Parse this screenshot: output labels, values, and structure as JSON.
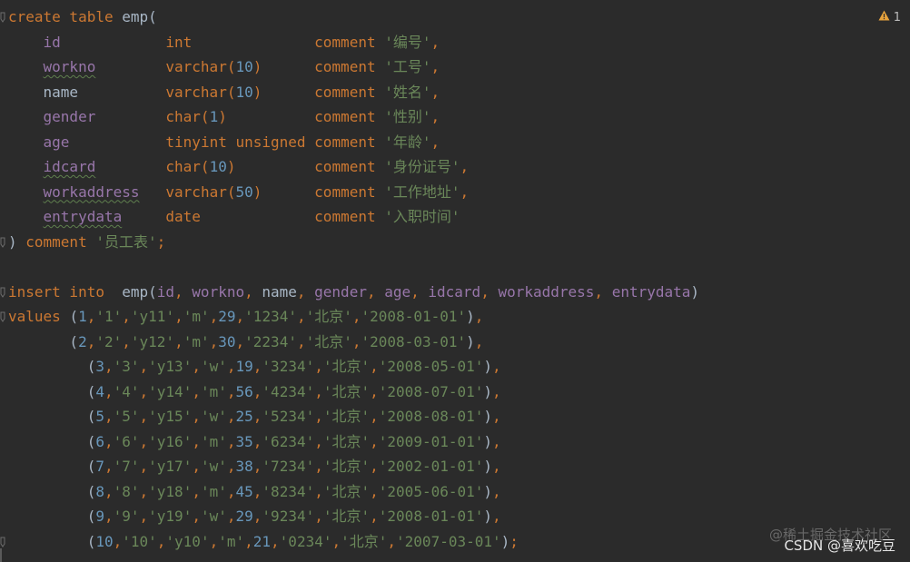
{
  "editor": {
    "warning_count": "1",
    "lines": [
      [
        [
          "kw",
          "create table "
        ],
        [
          "id",
          "emp("
        ]
      ],
      [
        [
          "id",
          "    "
        ],
        [
          "col",
          "id"
        ],
        [
          "id",
          "            "
        ],
        [
          "kw",
          "int"
        ],
        [
          "id",
          "              "
        ],
        [
          "kw",
          "comment "
        ],
        [
          "str",
          "'编号'"
        ],
        [
          "kw",
          ","
        ]
      ],
      [
        [
          "id",
          "    "
        ],
        [
          "col typo",
          "workno"
        ],
        [
          "id",
          "        "
        ],
        [
          "kw",
          "varchar("
        ],
        [
          "num",
          "10"
        ],
        [
          "kw",
          ")"
        ],
        [
          "id",
          "      "
        ],
        [
          "kw",
          "comment "
        ],
        [
          "str",
          "'工号'"
        ],
        [
          "kw",
          ","
        ]
      ],
      [
        [
          "id",
          "    "
        ],
        [
          "id",
          "name"
        ],
        [
          "id",
          "          "
        ],
        [
          "kw",
          "varchar("
        ],
        [
          "num",
          "10"
        ],
        [
          "kw",
          ")"
        ],
        [
          "id",
          "      "
        ],
        [
          "kw",
          "comment "
        ],
        [
          "str",
          "'姓名'"
        ],
        [
          "kw",
          ","
        ]
      ],
      [
        [
          "id",
          "    "
        ],
        [
          "col",
          "gender"
        ],
        [
          "id",
          "        "
        ],
        [
          "kw",
          "char("
        ],
        [
          "num",
          "1"
        ],
        [
          "kw",
          ")"
        ],
        [
          "id",
          "          "
        ],
        [
          "kw",
          "comment "
        ],
        [
          "str",
          "'性别'"
        ],
        [
          "kw",
          ","
        ]
      ],
      [
        [
          "id",
          "    "
        ],
        [
          "col",
          "age"
        ],
        [
          "id",
          "           "
        ],
        [
          "kw",
          "tinyint unsigned"
        ],
        [
          "id",
          " "
        ],
        [
          "kw",
          "comment "
        ],
        [
          "str",
          "'年龄'"
        ],
        [
          "kw",
          ","
        ]
      ],
      [
        [
          "id",
          "    "
        ],
        [
          "col typo",
          "idcard"
        ],
        [
          "id",
          "        "
        ],
        [
          "kw",
          "char("
        ],
        [
          "num",
          "10"
        ],
        [
          "kw",
          ")"
        ],
        [
          "id",
          "         "
        ],
        [
          "kw",
          "comment "
        ],
        [
          "str",
          "'身份证号'"
        ],
        [
          "kw",
          ","
        ]
      ],
      [
        [
          "id",
          "    "
        ],
        [
          "col typo",
          "workaddress"
        ],
        [
          "id",
          "   "
        ],
        [
          "kw",
          "varchar("
        ],
        [
          "num",
          "50"
        ],
        [
          "kw",
          ")"
        ],
        [
          "id",
          "      "
        ],
        [
          "kw",
          "comment "
        ],
        [
          "str",
          "'工作地址'"
        ],
        [
          "kw",
          ","
        ]
      ],
      [
        [
          "id",
          "    "
        ],
        [
          "col typo",
          "entrydata"
        ],
        [
          "id",
          "     "
        ],
        [
          "kw",
          "date"
        ],
        [
          "id",
          "             "
        ],
        [
          "kw",
          "comment "
        ],
        [
          "str",
          "'入职时间'"
        ]
      ],
      [
        [
          "id",
          ") "
        ],
        [
          "kw",
          "comment "
        ],
        [
          "str",
          "'员工表'"
        ],
        [
          "kw",
          ";"
        ]
      ],
      [
        [
          "id",
          ""
        ]
      ],
      [
        [
          "kw",
          "insert into  "
        ],
        [
          "id",
          "emp("
        ],
        [
          "col",
          "id"
        ],
        [
          "kw",
          ", "
        ],
        [
          "col",
          "workno"
        ],
        [
          "kw",
          ", "
        ],
        [
          "id",
          "name"
        ],
        [
          "kw",
          ", "
        ],
        [
          "col",
          "gender"
        ],
        [
          "kw",
          ", "
        ],
        [
          "col",
          "age"
        ],
        [
          "kw",
          ", "
        ],
        [
          "col",
          "idcard"
        ],
        [
          "kw",
          ", "
        ],
        [
          "col",
          "workaddress"
        ],
        [
          "kw",
          ", "
        ],
        [
          "col",
          "entrydata"
        ],
        [
          "id",
          ")"
        ]
      ],
      [
        [
          "kw",
          "values "
        ],
        [
          "id",
          "("
        ],
        [
          "num",
          "1"
        ],
        [
          "kw",
          ","
        ],
        [
          "str",
          "'1'"
        ],
        [
          "kw",
          ","
        ],
        [
          "str",
          "'y11'"
        ],
        [
          "kw",
          ","
        ],
        [
          "str",
          "'m'"
        ],
        [
          "kw",
          ","
        ],
        [
          "num",
          "29"
        ],
        [
          "kw",
          ","
        ],
        [
          "str",
          "'1234'"
        ],
        [
          "kw",
          ","
        ],
        [
          "str",
          "'北京'"
        ],
        [
          "kw",
          ","
        ],
        [
          "str",
          "'2008-01-01'"
        ],
        [
          "id",
          ")"
        ],
        [
          "kw",
          ","
        ]
      ],
      [
        [
          "id",
          "       ("
        ],
        [
          "num",
          "2"
        ],
        [
          "kw",
          ","
        ],
        [
          "str",
          "'2'"
        ],
        [
          "kw",
          ","
        ],
        [
          "str",
          "'y12'"
        ],
        [
          "kw",
          ","
        ],
        [
          "str",
          "'m'"
        ],
        [
          "kw",
          ","
        ],
        [
          "num",
          "30"
        ],
        [
          "kw",
          ","
        ],
        [
          "str",
          "'2234'"
        ],
        [
          "kw",
          ","
        ],
        [
          "str",
          "'北京'"
        ],
        [
          "kw",
          ","
        ],
        [
          "str",
          "'2008-03-01'"
        ],
        [
          "id",
          ")"
        ],
        [
          "kw",
          ","
        ]
      ],
      [
        [
          "id",
          "         ("
        ],
        [
          "num",
          "3"
        ],
        [
          "kw",
          ","
        ],
        [
          "str",
          "'3'"
        ],
        [
          "kw",
          ","
        ],
        [
          "str",
          "'y13'"
        ],
        [
          "kw",
          ","
        ],
        [
          "str",
          "'w'"
        ],
        [
          "kw",
          ","
        ],
        [
          "num",
          "19"
        ],
        [
          "kw",
          ","
        ],
        [
          "str",
          "'3234'"
        ],
        [
          "kw",
          ","
        ],
        [
          "str",
          "'北京'"
        ],
        [
          "kw",
          ","
        ],
        [
          "str",
          "'2008-05-01'"
        ],
        [
          "id",
          ")"
        ],
        [
          "kw",
          ","
        ]
      ],
      [
        [
          "id",
          "         ("
        ],
        [
          "num",
          "4"
        ],
        [
          "kw",
          ","
        ],
        [
          "str",
          "'4'"
        ],
        [
          "kw",
          ","
        ],
        [
          "str",
          "'y14'"
        ],
        [
          "kw",
          ","
        ],
        [
          "str",
          "'m'"
        ],
        [
          "kw",
          ","
        ],
        [
          "num",
          "56"
        ],
        [
          "kw",
          ","
        ],
        [
          "str",
          "'4234'"
        ],
        [
          "kw",
          ","
        ],
        [
          "str",
          "'北京'"
        ],
        [
          "kw",
          ","
        ],
        [
          "str",
          "'2008-07-01'"
        ],
        [
          "id",
          ")"
        ],
        [
          "kw",
          ","
        ]
      ],
      [
        [
          "id",
          "         ("
        ],
        [
          "num",
          "5"
        ],
        [
          "kw",
          ","
        ],
        [
          "str",
          "'5'"
        ],
        [
          "kw",
          ","
        ],
        [
          "str",
          "'y15'"
        ],
        [
          "kw",
          ","
        ],
        [
          "str",
          "'w'"
        ],
        [
          "kw",
          ","
        ],
        [
          "num",
          "25"
        ],
        [
          "kw",
          ","
        ],
        [
          "str",
          "'5234'"
        ],
        [
          "kw",
          ","
        ],
        [
          "str",
          "'北京'"
        ],
        [
          "kw",
          ","
        ],
        [
          "str",
          "'2008-08-01'"
        ],
        [
          "id",
          ")"
        ],
        [
          "kw",
          ","
        ]
      ],
      [
        [
          "id",
          "         ("
        ],
        [
          "num",
          "6"
        ],
        [
          "kw",
          ","
        ],
        [
          "str",
          "'6'"
        ],
        [
          "kw",
          ","
        ],
        [
          "str",
          "'y16'"
        ],
        [
          "kw",
          ","
        ],
        [
          "str",
          "'m'"
        ],
        [
          "kw",
          ","
        ],
        [
          "num",
          "35"
        ],
        [
          "kw",
          ","
        ],
        [
          "str",
          "'6234'"
        ],
        [
          "kw",
          ","
        ],
        [
          "str",
          "'北京'"
        ],
        [
          "kw",
          ","
        ],
        [
          "str",
          "'2009-01-01'"
        ],
        [
          "id",
          ")"
        ],
        [
          "kw",
          ","
        ]
      ],
      [
        [
          "id",
          "         ("
        ],
        [
          "num",
          "7"
        ],
        [
          "kw",
          ","
        ],
        [
          "str",
          "'7'"
        ],
        [
          "kw",
          ","
        ],
        [
          "str",
          "'y17'"
        ],
        [
          "kw",
          ","
        ],
        [
          "str",
          "'w'"
        ],
        [
          "kw",
          ","
        ],
        [
          "num",
          "38"
        ],
        [
          "kw",
          ","
        ],
        [
          "str",
          "'7234'"
        ],
        [
          "kw",
          ","
        ],
        [
          "str",
          "'北京'"
        ],
        [
          "kw",
          ","
        ],
        [
          "str",
          "'2002-01-01'"
        ],
        [
          "id",
          ")"
        ],
        [
          "kw",
          ","
        ]
      ],
      [
        [
          "id",
          "         ("
        ],
        [
          "num",
          "8"
        ],
        [
          "kw",
          ","
        ],
        [
          "str",
          "'8'"
        ],
        [
          "kw",
          ","
        ],
        [
          "str",
          "'y18'"
        ],
        [
          "kw",
          ","
        ],
        [
          "str",
          "'m'"
        ],
        [
          "kw",
          ","
        ],
        [
          "num",
          "45"
        ],
        [
          "kw",
          ","
        ],
        [
          "str",
          "'8234'"
        ],
        [
          "kw",
          ","
        ],
        [
          "str",
          "'北京'"
        ],
        [
          "kw",
          ","
        ],
        [
          "str",
          "'2005-06-01'"
        ],
        [
          "id",
          ")"
        ],
        [
          "kw",
          ","
        ]
      ],
      [
        [
          "id",
          "         ("
        ],
        [
          "num",
          "9"
        ],
        [
          "kw",
          ","
        ],
        [
          "str",
          "'9'"
        ],
        [
          "kw",
          ","
        ],
        [
          "str",
          "'y19'"
        ],
        [
          "kw",
          ","
        ],
        [
          "str",
          "'w'"
        ],
        [
          "kw",
          ","
        ],
        [
          "num",
          "29"
        ],
        [
          "kw",
          ","
        ],
        [
          "str",
          "'9234'"
        ],
        [
          "kw",
          ","
        ],
        [
          "str",
          "'北京'"
        ],
        [
          "kw",
          ","
        ],
        [
          "str",
          "'2008-01-01'"
        ],
        [
          "id",
          ")"
        ],
        [
          "kw",
          ","
        ]
      ],
      [
        [
          "id",
          "         ("
        ],
        [
          "num",
          "10"
        ],
        [
          "kw",
          ","
        ],
        [
          "str",
          "'10'"
        ],
        [
          "kw",
          ","
        ],
        [
          "str",
          "'y10'"
        ],
        [
          "kw",
          ","
        ],
        [
          "str",
          "'m'"
        ],
        [
          "kw",
          ","
        ],
        [
          "num",
          "21"
        ],
        [
          "kw",
          ","
        ],
        [
          "str",
          "'0234'"
        ],
        [
          "kw",
          ","
        ],
        [
          "str",
          "'北京'"
        ],
        [
          "kw",
          ","
        ],
        [
          "str",
          "'2007-03-01'"
        ],
        [
          "id",
          ")"
        ],
        [
          "kw",
          ";"
        ]
      ]
    ],
    "fold_markers": [
      0,
      9,
      11,
      12,
      21
    ]
  },
  "watermark": {
    "line1": "@稀土掘金技术社区",
    "line2": "CSDN @喜欢吃豆"
  },
  "colors": {
    "background": "#2b2b2b",
    "keyword": "#cc7832",
    "identifier": "#a9b7c6",
    "column": "#9876aa",
    "number": "#6897bb",
    "string": "#6a8759",
    "warning": "#e6a23c"
  },
  "icons": {
    "warning": "warning-triangle-icon",
    "fold": "fold-marker-icon"
  }
}
